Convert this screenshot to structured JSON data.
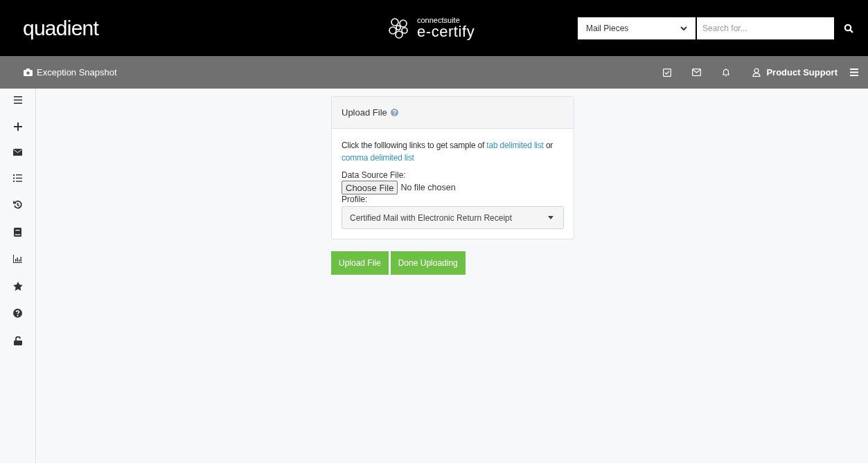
{
  "header": {
    "logo": "quadient",
    "product_line": "connectsuite",
    "product_name": "e-certify",
    "search_scope": "Mail Pieces",
    "search": {
      "placeholder": "Search for..."
    }
  },
  "toolbar": {
    "title": "Exception Snapshot",
    "user": "Product Support"
  },
  "upload_panel": {
    "title": "Upload File",
    "intro": "Click the folllowing links to get sample of",
    "link_1": "tab delimited list",
    "joiner": "or",
    "link_2": "comma delimited list",
    "file_label": "Data Source File:",
    "choose_button": "Choose File",
    "file_status": "No file chosen",
    "profile_label": "Profile:",
    "profile_value": "Certified Mail with Electronic Return Receipt"
  },
  "buttons": [
    "Upload File",
    "Done Uploading"
  ]
}
